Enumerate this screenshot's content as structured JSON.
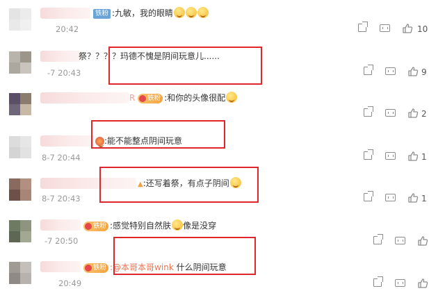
{
  "colors": {
    "annotation_border": "#e0262b",
    "muted_text": "#999999",
    "mention": "#eb7350",
    "fan_badge_blue": "#6aa3d8",
    "fan_badge_gold": "#f5a340"
  },
  "comments": [
    {
      "badge": "铁粉",
      "text": ":九敏，我的眼睛",
      "emojis": [
        "emoji-icon",
        "emoji-icon",
        "emoji-icon"
      ],
      "time": "20:42",
      "like_count": "10"
    },
    {
      "text": "祭？？？？玛德不愧是阴间玩意儿......",
      "time": "-7 20:43",
      "like_count": "9"
    },
    {
      "name_tail": "R",
      "badge": "铁粉",
      "text": ":和你的头像很配",
      "emojis": [
        "emoji-icon"
      ],
      "time": "",
      "like_count": "2"
    },
    {
      "text": ":能不能整点阴间玩意",
      "time": "8-7 20:44",
      "like_count": "1"
    },
    {
      "text": ":还写着祭，有点子阴间",
      "emojis": [
        "emoji-icon"
      ],
      "time": "8-7 20:43",
      "like_count": "1"
    },
    {
      "badge": "铁粉",
      "text_before": ":感觉特别自然肤",
      "text_after": "像是没穿",
      "emojis": [
        "emoji-icon"
      ],
      "time": "-7 20:50",
      "like_count": ""
    },
    {
      "badge": "铁粉",
      "mention": ":@本哥本哥wink",
      "text": " 什么阴间玩意",
      "time": "20:49",
      "like_count": ""
    }
  ]
}
